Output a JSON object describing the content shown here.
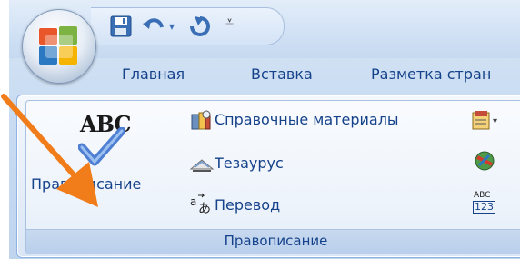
{
  "tabs": [
    "Главная",
    "Вставка",
    "Разметка стран"
  ],
  "ribbon": {
    "spelling_button": {
      "icon_text": "ABC",
      "label": "Правописание",
      "icon": "spell-check-icon"
    },
    "small_buttons": [
      {
        "label": "Справочные материалы",
        "icon": "research-icon"
      },
      {
        "label": "Тезаурус",
        "icon": "thesaurus-icon"
      },
      {
        "label": "Перевод",
        "icon": "translate-icon"
      }
    ],
    "right_icons": [
      "research-dropdown-icon",
      "language-icon",
      "word-count-icon"
    ],
    "word_count_text": [
      "ABC",
      "123"
    ],
    "group_label": "Правописание"
  },
  "quick_access": [
    "save-icon",
    "undo-icon",
    "redo-icon",
    "customize-dropdown-icon"
  ],
  "annotation": {
    "icon": "orange-arrow-icon",
    "color": "#f07d1a"
  },
  "colors": {
    "tab_text": "#15428b",
    "accent": "#f07d1a"
  }
}
